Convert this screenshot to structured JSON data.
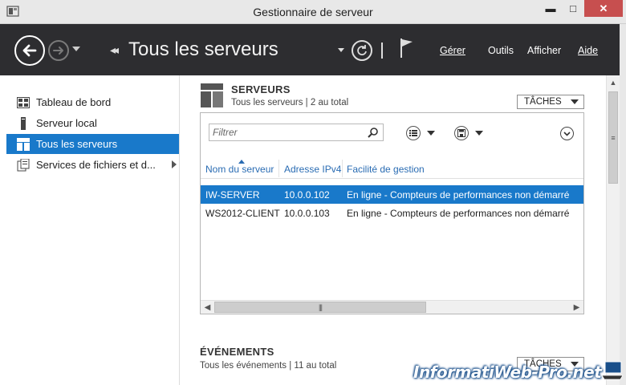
{
  "window": {
    "title": "Gestionnaire de serveur",
    "minimize": "▬",
    "maximize": "□",
    "close": "✕"
  },
  "header": {
    "breadcrumb_arrows": "◂◂",
    "page_title": "Tous les serveurs",
    "menu": {
      "gerer": "Gérer",
      "outils": "Outils",
      "afficher": "Afficher",
      "aide": "Aide"
    }
  },
  "sidebar": {
    "items": [
      {
        "label": "Tableau de bord",
        "icon": "dashboard-grid-icon"
      },
      {
        "label": "Serveur local",
        "icon": "server-icon"
      },
      {
        "label": "Tous les serveurs",
        "icon": "servers-icon",
        "active": true
      },
      {
        "label": "Services de fichiers et d...",
        "icon": "file-services-icon"
      }
    ]
  },
  "servers": {
    "title": "SERVEURS",
    "subtitle": "Tous les serveurs | 2 au total",
    "tasks_label": "TÂCHES",
    "filter_placeholder": "Filtrer",
    "columns": [
      "Nom du serveur",
      "Adresse IPv4",
      "Facilité de gestion"
    ],
    "rows": [
      {
        "name": "IW-SERVER",
        "ip": "10.0.0.102",
        "status": "En ligne - Compteurs de performances non démarré",
        "selected": true
      },
      {
        "name": "WS2012-CLIENT",
        "ip": "10.0.0.103",
        "status": "En ligne - Compteurs de performances non démarré",
        "selected": false
      }
    ]
  },
  "events": {
    "title": "ÉVÉNEMENTS",
    "subtitle": "Tous les événements | 11 au total",
    "tasks_label": "TÂCHES"
  },
  "watermark": "InformatiWeb-Pro.net",
  "colors": {
    "header_bg": "#2d2d30",
    "selection": "#1979ca",
    "link_blue": "#2a6cb3"
  }
}
